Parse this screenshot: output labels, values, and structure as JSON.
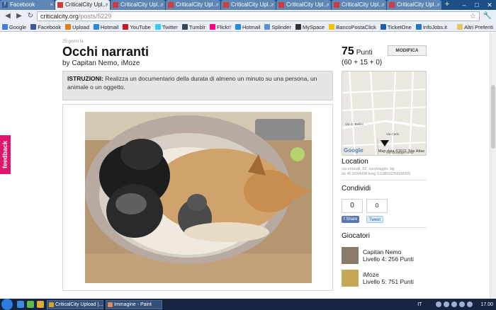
{
  "browser": {
    "tabs": [
      {
        "label": "Facebook",
        "favicon": "facebook-icon",
        "active": false
      },
      {
        "label": "CriticalCity Upl...",
        "favicon": "cc-icon",
        "active": true
      },
      {
        "label": "CriticalCity Upl...",
        "favicon": "cc-icon",
        "active": false
      },
      {
        "label": "CriticalCity Upl...",
        "favicon": "cc-icon",
        "active": false
      },
      {
        "label": "CriticalCity Upl...",
        "favicon": "cc-icon",
        "active": false
      },
      {
        "label": "CriticalCity Upl...",
        "favicon": "cc-icon",
        "active": false
      },
      {
        "label": "CriticalCity Upl...",
        "favicon": "cc-icon",
        "active": false
      },
      {
        "label": "CriticalCity Upl...",
        "favicon": "cc-icon",
        "active": false
      }
    ],
    "address_host": "criticalcity.org",
    "address_path": "/posts/5229",
    "bookmarks": [
      {
        "label": "Google",
        "color": "#4a7be0"
      },
      {
        "label": "Facebook",
        "color": "#3b5998"
      },
      {
        "label": "Upload",
        "color": "#e37b1b"
      },
      {
        "label": "Hotmail",
        "color": "#2b88d8"
      },
      {
        "label": "YouTube",
        "color": "#cc181e"
      },
      {
        "label": "Twitter",
        "color": "#33ccff"
      },
      {
        "label": "Tumblr",
        "color": "#35465c"
      },
      {
        "label": "Flickr!",
        "color": "#ff0084"
      },
      {
        "label": "Hotmail",
        "color": "#2b88d8"
      },
      {
        "label": "Splinder",
        "color": "#5b8fd6"
      },
      {
        "label": "MySpace",
        "color": "#333333"
      },
      {
        "label": "BancoPostaClick",
        "color": "#f2c200"
      },
      {
        "label": "TicketOne",
        "color": "#1e5fb3"
      },
      {
        "label": "InfoJobs.it",
        "color": "#1f77c6"
      }
    ],
    "bookmarks_other": "Altri Preferiti"
  },
  "post": {
    "ago": "25 giorni fa",
    "title": "Occhi narranti",
    "by_prefix": "by",
    "authors": "Capitan Nemo, iMoze",
    "instructions_label": "ISTRUZIONI:",
    "instructions_text": "Realizza un documentario della durata di almeno un minuto su una persona, un animale o un oggetto."
  },
  "sidebar": {
    "points": "75",
    "points_label": "Punti",
    "points_breakdown": "(60 + 15 + 0)",
    "edit_label": "MODIFICA",
    "map_attribution": "Map data ©2011 Tele Atlas",
    "map_logo": "Google",
    "map_streets": [
      "Via Giuseppe Verdi",
      "Via G. Bellini",
      "Via Carlo"
    ],
    "location_title": "Location",
    "location_address": "via einaudi, 52, caravaggio, bg",
    "location_coords": "lat 45.5044998 long 9.63803230000005",
    "share_title": "Condividi",
    "fb_count": "0",
    "tw_count": "0",
    "fb_share": "Share",
    "tw_share": "Tweet",
    "players_title": "Giocatori",
    "players": [
      {
        "name": "Capitan Nemo",
        "level": "Livello 4: 256 Punti"
      },
      {
        "name": "iMoze",
        "level": "Livello 5: 751 Punti"
      }
    ]
  },
  "feedback_label": "feedback",
  "taskbar": {
    "tasks": [
      "CriticalCity Upload |...",
      "Immagine - Paint"
    ],
    "lang": "IT",
    "clock": "17.00"
  }
}
